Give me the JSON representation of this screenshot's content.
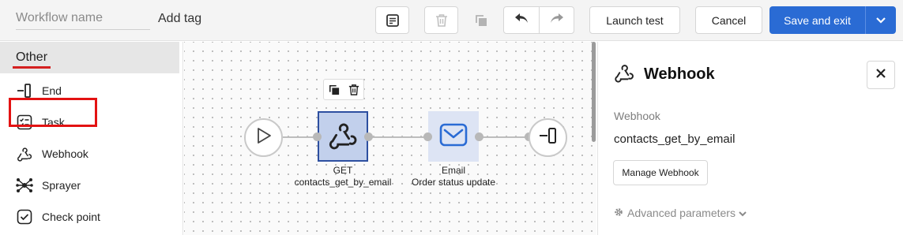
{
  "toolbar": {
    "workflow_name_placeholder": "Workflow name",
    "workflow_name_value": "",
    "add_tag_label": "Add tag",
    "launch_test_label": "Launch test",
    "cancel_label": "Cancel",
    "save_label": "Save and exit"
  },
  "sidebar": {
    "category": "Other",
    "items": [
      {
        "label": "End",
        "icon": "end-icon"
      },
      {
        "label": "Task",
        "icon": "task-icon"
      },
      {
        "label": "Webhook",
        "icon": "webhook-icon",
        "highlighted": true
      },
      {
        "label": "Sprayer",
        "icon": "sprayer-icon"
      },
      {
        "label": "Check point",
        "icon": "check-point-icon"
      }
    ]
  },
  "canvas": {
    "webhook_node": {
      "method": "GET",
      "name": "contacts_get_by_email"
    },
    "email_node": {
      "type": "Email",
      "name": "Order status update"
    }
  },
  "panel": {
    "title": "Webhook",
    "field_label": "Webhook",
    "field_value": "contacts_get_by_email",
    "manage_label": "Manage Webhook",
    "advanced_label": "Advanced parameters"
  },
  "colors": {
    "primary": "#2a6bd4",
    "highlight": "#e31212",
    "node_selected_fill": "#c2d0ec",
    "node_selected_border": "#2d4fa0",
    "email_node_fill": "#dde4f4"
  }
}
